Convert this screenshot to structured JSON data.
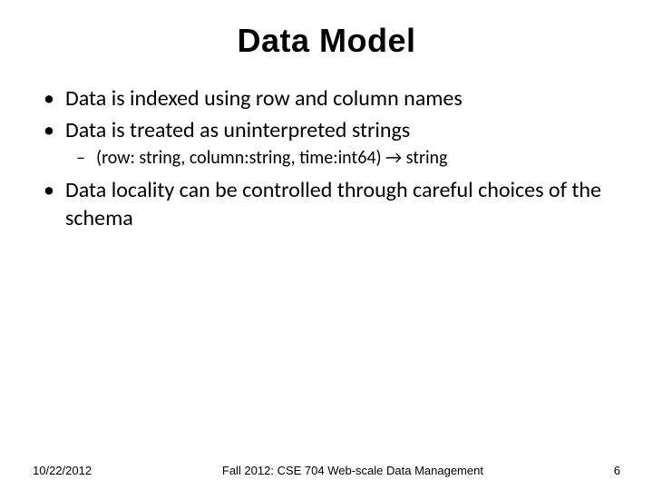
{
  "title": "Data Model",
  "bullets": {
    "b1": "Data is indexed using row and column names",
    "b2": "Data is treated as uninterpreted strings",
    "b2_sub1": "(row: string, column:string, time:int64) → string",
    "b3": "Data locality can be controlled through careful choices of the schema"
  },
  "footer": {
    "date": "10/22/2012",
    "center": "Fall 2012: CSE 704 Web-scale Data Management",
    "page": "6"
  }
}
